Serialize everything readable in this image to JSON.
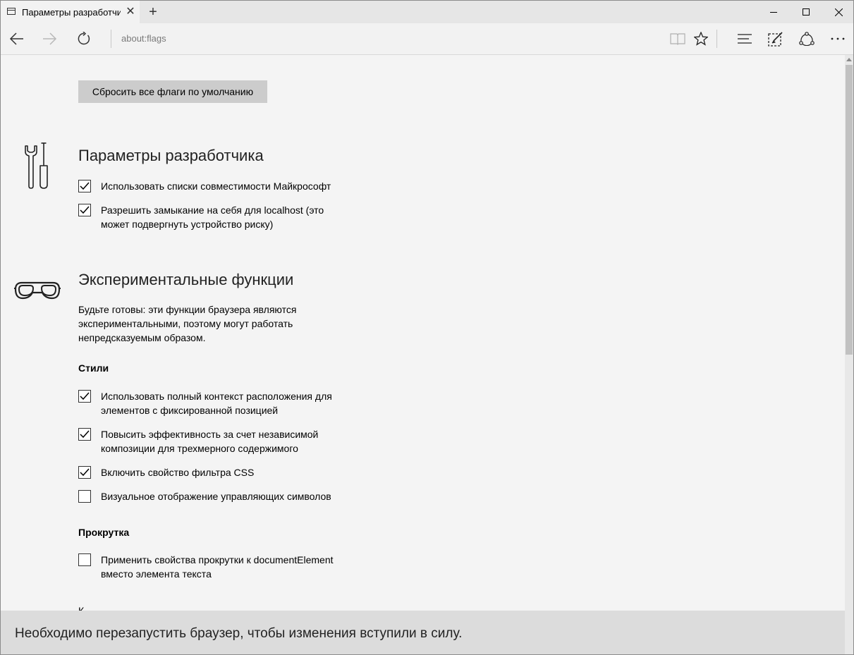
{
  "tab": {
    "title": "Параметры разработчи",
    "close_label": "✕",
    "new_tab_label": "+"
  },
  "window_buttons": [
    "minimize",
    "maximize",
    "close"
  ],
  "address_bar": {
    "url": "about:flags"
  },
  "toolbar_icons": [
    "back-icon",
    "forward-icon",
    "refresh-icon",
    "reading-view-icon",
    "favorite-star-icon",
    "hub-icon",
    "web-note-icon",
    "share-icon",
    "more-icon"
  ],
  "content": {
    "reset_button": "Сбросить все флаги по умолчанию",
    "developer": {
      "title": "Параметры разработчика",
      "icon": "tools-icon",
      "options": [
        {
          "label": "Использовать списки совместимости Майкрософт",
          "checked": true
        },
        {
          "label": "Разрешить замыкание на себя для localhost (это может подвергнуть устройство риску)",
          "checked": true
        }
      ]
    },
    "experimental": {
      "title": "Экспериментальные функции",
      "icon": "goggles-icon",
      "description": "Будьте готовы: эти функции браузера являются экспериментальными, поэтому могут работать непредсказуемым образом.",
      "styles": {
        "heading": "Стили",
        "options": [
          {
            "label": "Использовать полный контекст расположения для элементов с фиксированной позицией",
            "checked": true
          },
          {
            "label": "Повысить эффективность за счет независимой композиции для трехмерного содержимого",
            "checked": true
          },
          {
            "label": "Включить свойство фильтра CSS",
            "checked": true
          },
          {
            "label": "Визуальное отображение управляющих символов",
            "checked": false
          }
        ]
      },
      "scrolling": {
        "heading": "Прокрутка",
        "options": [
          {
            "label": "Применить свойства прокрутки к documentElement вместо элемента текста",
            "checked": false
          }
        ]
      },
      "next_heading_partial": "К"
    }
  },
  "notification": {
    "text": "Необходимо перезапустить браузер, чтобы изменения вступили в силу."
  }
}
